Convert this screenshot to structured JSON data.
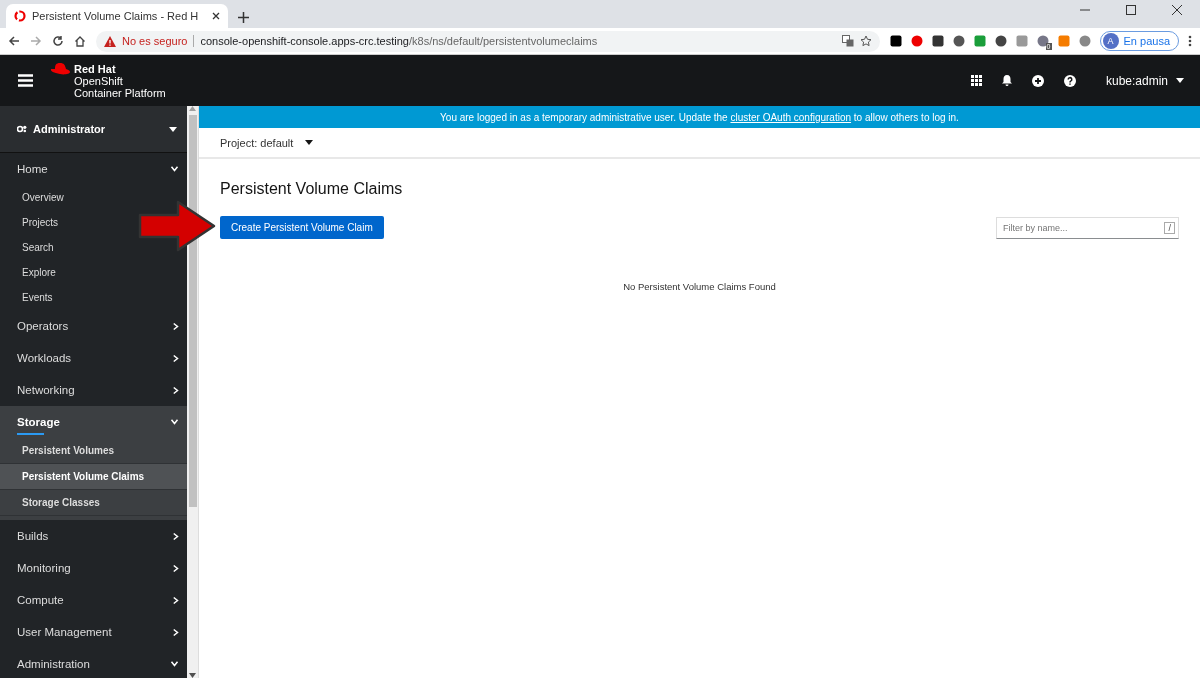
{
  "browser": {
    "tab_title": "Persistent Volume Claims - Red H",
    "security_label": "No es seguro",
    "url_host": "console-openshift-console.apps-crc.testing",
    "url_path": "/k8s/ns/default/persistentvolumeclaims",
    "extension_badge": "0",
    "profile_initial": "A",
    "profile_label": "En pausa"
  },
  "masthead": {
    "brand": [
      "Red Hat",
      "OpenShift",
      "Container Platform"
    ],
    "user": "kube:admin"
  },
  "sidebar": {
    "perspective": "Administrator",
    "nav": [
      {
        "label": "Home",
        "expanded": true,
        "selected": false,
        "children": [
          {
            "label": "Overview",
            "selected": false
          },
          {
            "label": "Projects",
            "selected": false
          },
          {
            "label": "Search",
            "selected": false
          },
          {
            "label": "Explore",
            "selected": false
          },
          {
            "label": "Events",
            "selected": false
          }
        ]
      },
      {
        "label": "Operators",
        "expanded": false,
        "selected": false
      },
      {
        "label": "Workloads",
        "expanded": false,
        "selected": false
      },
      {
        "label": "Networking",
        "expanded": false,
        "selected": false
      },
      {
        "label": "Storage",
        "expanded": true,
        "selected": true,
        "children": [
          {
            "label": "Persistent Volumes",
            "selected": false
          },
          {
            "label": "Persistent Volume Claims",
            "selected": true
          },
          {
            "label": "Storage Classes",
            "selected": false
          }
        ]
      },
      {
        "label": "Builds",
        "expanded": false,
        "selected": false
      },
      {
        "label": "Monitoring",
        "expanded": false,
        "selected": false
      },
      {
        "label": "Compute",
        "expanded": false,
        "selected": false
      },
      {
        "label": "User Management",
        "expanded": false,
        "selected": false
      },
      {
        "label": "Administration",
        "expanded": true,
        "selected": false
      }
    ]
  },
  "banner": {
    "before": "You are logged in as a temporary administrative user. Update the",
    "link": "cluster OAuth configuration",
    "after": "to allow others to log in."
  },
  "project": "Project: default",
  "page": {
    "title": "Persistent Volume Claims",
    "create_button": "Create Persistent Volume Claim",
    "filter_placeholder": "Filter by name...",
    "filter_key": "/",
    "empty_message": "No Persistent Volume Claims Found"
  }
}
